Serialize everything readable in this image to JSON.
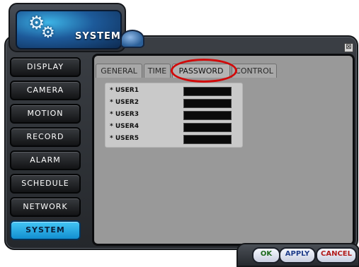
{
  "window": {
    "title": "SYSTEM",
    "close_label": "⊠"
  },
  "sidebar": {
    "items": [
      {
        "label": "DISPLAY",
        "active": false
      },
      {
        "label": "CAMERA",
        "active": false
      },
      {
        "label": "MOTION",
        "active": false
      },
      {
        "label": "RECORD",
        "active": false
      },
      {
        "label": "ALARM",
        "active": false
      },
      {
        "label": "SCHEDULE",
        "active": false
      },
      {
        "label": "NETWORK",
        "active": false
      },
      {
        "label": "SYSTEM",
        "active": true
      }
    ]
  },
  "tabs": [
    {
      "label": "GENERAL",
      "active": false
    },
    {
      "label": "TIME",
      "active": false
    },
    {
      "label": "PASSWORD",
      "active": true
    },
    {
      "label": "CONTROL",
      "active": false
    }
  ],
  "password": {
    "users": [
      {
        "label": "* USER1",
        "value": ""
      },
      {
        "label": "* USER2",
        "value": ""
      },
      {
        "label": "* USER3",
        "value": ""
      },
      {
        "label": "* USER4",
        "value": ""
      },
      {
        "label": "* USER5",
        "value": ""
      }
    ]
  },
  "buttons": {
    "ok": "OK",
    "apply": "APPLY",
    "cancel": "CANCEL"
  },
  "colors": {
    "accent": "#1aa3e0",
    "highlight": "#d10a0a",
    "panel": "#999999"
  },
  "icons": {
    "header": "gear-icon"
  }
}
